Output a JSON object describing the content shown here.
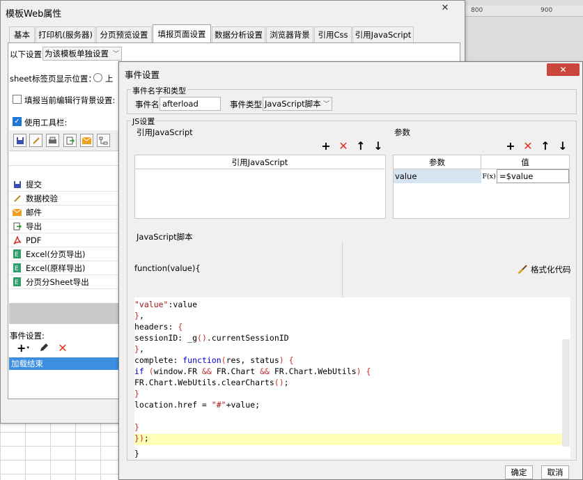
{
  "ruler": {
    "mark1": "800",
    "mark2": "900"
  },
  "template_window": {
    "title": "模板Web属性",
    "close_glyph": "✕",
    "tabs": [
      "基本",
      "打印机(服务器)",
      "分页预览设置",
      "填报页面设置",
      "数据分析设置",
      "浏览器背景",
      "引用Css",
      "引用JavaScript"
    ],
    "active_tab": "填报页面设置",
    "settings_label": "以下设置:",
    "settings_value": "为该模板单独设置",
    "sheet_tab_label": "sheet标签页显示位置：",
    "sheet_tab_option": "上",
    "fill_bg_label": "填报当前编辑行背景设置:",
    "use_toolbar_label": "使用工具栏:",
    "toolbar_items": [
      "提交",
      "数据校验",
      "邮件",
      "导出",
      "PDF",
      "Excel(分页导出)",
      "Excel(原样导出)",
      "分页分Sheet导出"
    ],
    "event_settings_label": "事件设置:",
    "events": [
      "加载结束"
    ]
  },
  "event_dialog": {
    "title": "事件设置",
    "close_glyph": "✕",
    "name_type_group": "事件名字和类型",
    "event_name_label": "事件名:",
    "event_name_value": "afterload",
    "event_type_label": "事件类型:",
    "event_type_value": "JavaScript脚本",
    "js_group": "JS设置",
    "ref_js_label": "引用JavaScript",
    "ref_js_header": "引用JavaScript",
    "params_label": "参数",
    "params_headers": [
      "参数",
      "值"
    ],
    "param_row": {
      "name": "value",
      "formula_glyph": "F(x)",
      "value": "=$value"
    },
    "script_label": "JavaScript脚本",
    "function_signature": "function(value){",
    "format_button": "格式化代码",
    "code_lines": [
      "\"value\":value",
      "},",
      "headers: {",
      "sessionID: _g().currentSessionID",
      "},",
      "complete: function(res, status) {",
      "if (window.FR && FR.Chart && FR.Chart.WebUtils) {",
      "FR.Chart.WebUtils.clearCharts();",
      "}",
      "location.href = \"#\"+value;",
      "",
      "}",
      "});"
    ],
    "closing_brace": "}",
    "ok_button": "确定",
    "cancel_button": "取消"
  },
  "colors": {
    "selection": "#3d8ee0",
    "highlight_line": "#ffffb8",
    "param_selected": "#d7e5f2",
    "red_x": "#e0321e"
  }
}
